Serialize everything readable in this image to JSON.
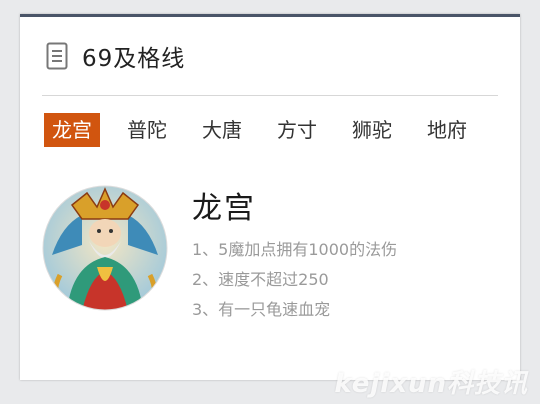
{
  "header": {
    "title": "69及格线",
    "icon": "document-icon"
  },
  "tabs": [
    {
      "label": "龙宫",
      "active": true
    },
    {
      "label": "普陀",
      "active": false
    },
    {
      "label": "大唐",
      "active": false
    },
    {
      "label": "方寸",
      "active": false
    },
    {
      "label": "狮驼",
      "active": false
    },
    {
      "label": "地府",
      "active": false
    }
  ],
  "detail": {
    "title": "龙宫",
    "rules": [
      "1、5魔加点拥有1000的法伤",
      "2、速度不超过250",
      "3、有一只龟速血宠"
    ]
  },
  "watermark": "kejixun科技讯",
  "colors": {
    "accent": "#d1550f",
    "top_border": "#4a5568"
  }
}
